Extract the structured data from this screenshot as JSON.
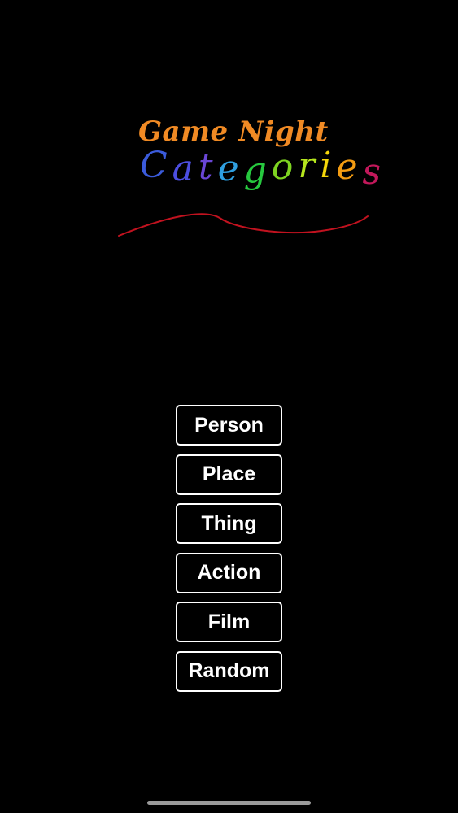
{
  "logo": {
    "title": "Game Night",
    "title_color": "#f08a24",
    "subtitle_letters": [
      {
        "char": "C",
        "color": "#3b5bdb"
      },
      {
        "char": "a",
        "color": "#4c4ee0"
      },
      {
        "char": "t",
        "color": "#6a46d6"
      },
      {
        "char": "e",
        "color": "#2f9fe0"
      },
      {
        "char": "g",
        "color": "#27c93f"
      },
      {
        "char": "o",
        "color": "#7ed321"
      },
      {
        "char": "r",
        "color": "#b5e61d"
      },
      {
        "char": "i",
        "color": "#f5d60a"
      },
      {
        "char": "e",
        "color": "#f39c12"
      },
      {
        "char": "s",
        "color": "#c2185b"
      }
    ],
    "swoosh_color": "#c1121f"
  },
  "menu": {
    "items": [
      {
        "label": "Person"
      },
      {
        "label": "Place"
      },
      {
        "label": "Thing"
      },
      {
        "label": "Action"
      },
      {
        "label": "Film"
      },
      {
        "label": "Random"
      }
    ]
  }
}
